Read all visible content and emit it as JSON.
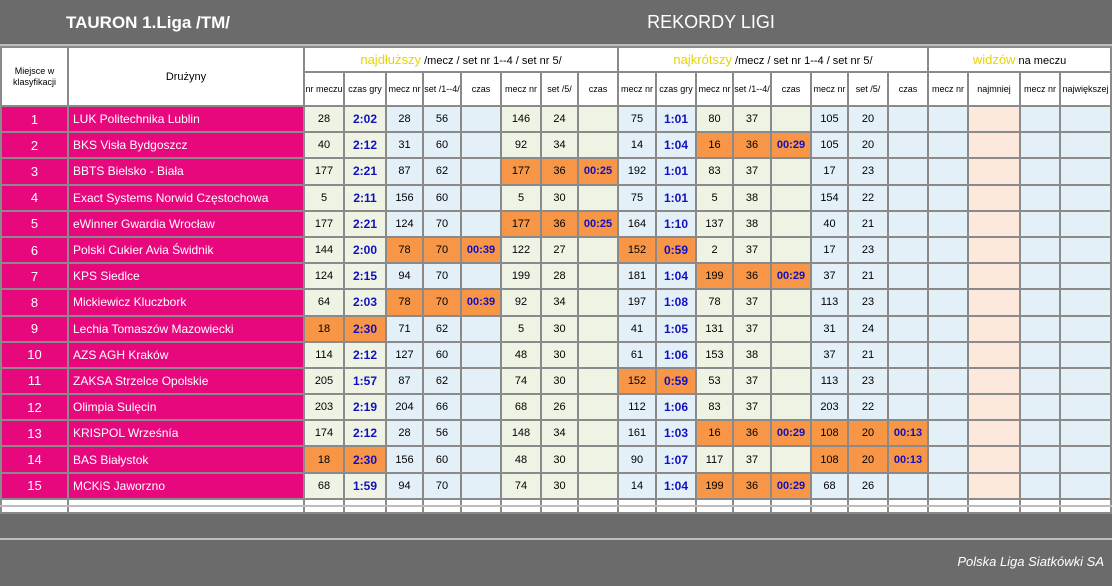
{
  "header": {
    "league": "TAURON 1.Liga /TM/",
    "title": "REKORDY LIGI"
  },
  "columns": {
    "place_h": "Miejsce w klasyfikacji",
    "team_h": "Drużyny",
    "longest_hl": "najdłuższy",
    "longest_rest": " /mecz / set nr 1--4 / set nr 5/",
    "shortest_hl": "najkrótszy",
    "shortest_rest": " /mecz / set nr 1--4 / set nr 5/",
    "viewers_hl": "widzów",
    "viewers_rest": " na meczu",
    "sub": [
      "nr meczu",
      "czas gry",
      "mecz nr",
      "set /1--4/",
      "czas",
      "mecz nr",
      "set /5/",
      "czas",
      "mecz nr",
      "czas gry",
      "mecz nr",
      "set /1--4/",
      "czas",
      "mecz nr",
      "set /5/",
      "czas",
      "mecz nr",
      "najmniej",
      "mecz nr",
      "największej"
    ]
  },
  "rows": [
    {
      "p": "1",
      "team": "LUK Politechnika Lublin",
      "v": [
        "28",
        "2:02",
        "28",
        "56",
        "",
        "146",
        "24",
        "",
        "75",
        "1:01",
        "80",
        "37",
        "",
        "105",
        "20",
        "",
        "",
        "",
        "",
        ""
      ]
    },
    {
      "p": "2",
      "team": "BKS Visła Bydgoszcz",
      "v": [
        "40",
        "2:12",
        "31",
        "60",
        "",
        "92",
        "34",
        "",
        "14",
        "1:04",
        "16",
        "36",
        "00:29",
        "105",
        "20",
        "",
        "",
        "",
        "",
        ""
      ]
    },
    {
      "p": "3",
      "team": "BBTS Bielsko - Biała",
      "v": [
        "177",
        "2:21",
        "87",
        "62",
        "",
        "177",
        "36",
        "00:25",
        "192",
        "1:01",
        "83",
        "37",
        "",
        "17",
        "23",
        "",
        "",
        "",
        "",
        ""
      ]
    },
    {
      "p": "4",
      "team": "Exact Systems Norwid Częstochowa",
      "v": [
        "5",
        "2:11",
        "156",
        "60",
        "",
        "5",
        "30",
        "",
        "75",
        "1:01",
        "5",
        "38",
        "",
        "154",
        "22",
        "",
        "",
        "",
        "",
        ""
      ]
    },
    {
      "p": "5",
      "team": "eWinner Gwardia Wrocław",
      "v": [
        "177",
        "2:21",
        "124",
        "70",
        "",
        "177",
        "36",
        "00:25",
        "164",
        "1:10",
        "137",
        "38",
        "",
        "40",
        "21",
        "",
        "",
        "",
        "",
        ""
      ]
    },
    {
      "p": "6",
      "team": "Polski Cukier Avia Świdnik",
      "v": [
        "144",
        "2:00",
        "78",
        "70",
        "00:39",
        "122",
        "27",
        "",
        "152",
        "0:59",
        "2",
        "37",
        "",
        "17",
        "23",
        "",
        "",
        "",
        "",
        ""
      ]
    },
    {
      "p": "7",
      "team": "KPS Siedlce",
      "v": [
        "124",
        "2:15",
        "94",
        "70",
        "",
        "199",
        "28",
        "",
        "181",
        "1:04",
        "199",
        "36",
        "00:29",
        "37",
        "21",
        "",
        "",
        "",
        "",
        ""
      ]
    },
    {
      "p": "8",
      "team": "Mickiewicz Kluczbork",
      "v": [
        "64",
        "2:03",
        "78",
        "70",
        "00:39",
        "92",
        "34",
        "",
        "197",
        "1:08",
        "78",
        "37",
        "",
        "113",
        "23",
        "",
        "",
        "",
        "",
        ""
      ]
    },
    {
      "p": "9",
      "team": "Lechia Tomaszów Mazowiecki",
      "v": [
        "18",
        "2:30",
        "71",
        "62",
        "",
        "5",
        "30",
        "",
        "41",
        "1:05",
        "131",
        "37",
        "",
        "31",
        "24",
        "",
        "",
        "",
        "",
        ""
      ]
    },
    {
      "p": "10",
      "team": "AZS AGH Kraków",
      "v": [
        "114",
        "2:12",
        "127",
        "60",
        "",
        "48",
        "30",
        "",
        "61",
        "1:06",
        "153",
        "38",
        "",
        "37",
        "21",
        "",
        "",
        "",
        "",
        ""
      ]
    },
    {
      "p": "11",
      "team": "ZAKSA Strzelce Opolskie",
      "v": [
        "205",
        "1:57",
        "87",
        "62",
        "",
        "74",
        "30",
        "",
        "152",
        "0:59",
        "53",
        "37",
        "",
        "113",
        "23",
        "",
        "",
        "",
        "",
        ""
      ]
    },
    {
      "p": "12",
      "team": "Olimpia Sulęcin",
      "v": [
        "203",
        "2:19",
        "204",
        "66",
        "",
        "68",
        "26",
        "",
        "112",
        "1:06",
        "83",
        "37",
        "",
        "203",
        "22",
        "",
        "",
        "",
        "",
        ""
      ]
    },
    {
      "p": "13",
      "team": "KRISPOL Wrześnía",
      "v": [
        "174",
        "2:12",
        "28",
        "56",
        "",
        "148",
        "34",
        "",
        "161",
        "1:03",
        "16",
        "36",
        "00:29",
        "108",
        "20",
        "00:13",
        "",
        "",
        "",
        ""
      ]
    },
    {
      "p": "14",
      "team": "BAS Białystok",
      "v": [
        "18",
        "2:30",
        "156",
        "60",
        "",
        "48",
        "30",
        "",
        "90",
        "1:07",
        "117",
        "37",
        "",
        "108",
        "20",
        "00:13",
        "",
        "",
        "",
        ""
      ]
    },
    {
      "p": "15",
      "team": "MCKiS Jaworzno",
      "v": [
        "68",
        "1:59",
        "94",
        "70",
        "",
        "74",
        "30",
        "",
        "14",
        "1:04",
        "199",
        "36",
        "00:29",
        "68",
        "26",
        "",
        "",
        "",
        "",
        ""
      ]
    }
  ],
  "highlights": {
    "orange_cells": [
      [
        2,
        5
      ],
      [
        2,
        6
      ],
      [
        2,
        7
      ],
      [
        4,
        5
      ],
      [
        4,
        6
      ],
      [
        4,
        7
      ],
      [
        5,
        2
      ],
      [
        5,
        3
      ],
      [
        5,
        4
      ],
      [
        5,
        8
      ],
      [
        5,
        9
      ],
      [
        7,
        2
      ],
      [
        7,
        3
      ],
      [
        7,
        4
      ],
      [
        8,
        0
      ],
      [
        8,
        1
      ],
      [
        10,
        8
      ],
      [
        10,
        9
      ],
      [
        12,
        10
      ],
      [
        12,
        11
      ],
      [
        12,
        12
      ],
      [
        12,
        13
      ],
      [
        12,
        14
      ],
      [
        12,
        15
      ],
      [
        13,
        0
      ],
      [
        13,
        1
      ],
      [
        13,
        13
      ],
      [
        13,
        14
      ],
      [
        13,
        15
      ],
      [
        14,
        10
      ],
      [
        14,
        11
      ],
      [
        14,
        12
      ],
      [
        1,
        10
      ],
      [
        1,
        11
      ],
      [
        1,
        12
      ],
      [
        6,
        10
      ],
      [
        6,
        11
      ],
      [
        6,
        12
      ]
    ],
    "orange": "#f79646",
    "pink": "#e8087e"
  },
  "footer": {
    "credit": "Polska Liga Siatkówki SA"
  }
}
